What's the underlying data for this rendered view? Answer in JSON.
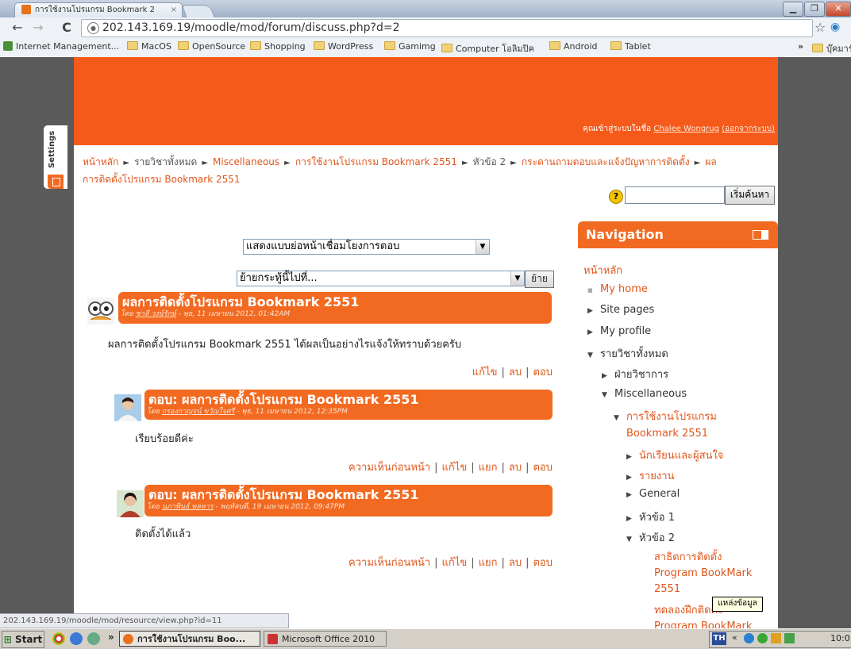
{
  "browser": {
    "tab_title": "การใช้งานโปรแกรม Bookmark 2",
    "tab_close": "×",
    "url": "202.143.169.19/moodle/mod/forum/discuss.php?d=2",
    "bookmarks": [
      "Internet Management...",
      "MacOS",
      "OpenSource",
      "Shopping",
      "WordPress",
      "Gamimg",
      "Computer โอลิมปิค",
      "Android",
      "Tablet"
    ],
    "bookmarks_more": "»",
    "other_bookmarks": "บุ๊คมาร์คอื่นๆ",
    "status_url": "202.143.169.19/moodle/mod/resource/view.php?id=11"
  },
  "header": {
    "login_prefix": "คุณเข้าสู่ระบบในชื่อ ",
    "user_name": "Chalee Wongrug",
    "logout": "(ออกจากระบบ)"
  },
  "settings_tab": {
    "label": "Settings"
  },
  "breadcrumb": {
    "home": "หน้าหลัก",
    "items": [
      "รายวิชาทั้งหมด",
      "Miscellaneous",
      "การใช้งานโปรแกรม Bookmark 2551",
      "หัวข้อ 2",
      "กระดานถามตอบและแจ้งปัญหาการติดตั้ง"
    ],
    "last_line1": "ผล",
    "last_line2": "การติดตั้งโปรแกรม Bookmark 2551",
    "separator": "►"
  },
  "search": {
    "help": "?",
    "button": "เริ่มค้นหา"
  },
  "forum": {
    "display_mode": "แสดงแบบย่อหน้าเชื่อมโยงการตอบ",
    "move_placeholder": "ย้ายกระทู้นี้ไปที่...",
    "move_button": "ย้าย"
  },
  "posts": [
    {
      "title": "ผลการติดตั้งโปรแกรม Bookmark 2551",
      "author_prefix": "โดย ",
      "author": "ชาลี วงษ์รักษ์",
      "date": " - พุธ, 11 เมษายน 2012, 01:42AM",
      "message": "ผลการติดตั้งโปรแกรม Bookmark 2551 ได้ผลเป็นอย่างไรแจ้งให้ทราบด้วยครับ",
      "commands": [
        "แก้ไข",
        "ลบ",
        "ตอบ"
      ]
    },
    {
      "title": "ตอบ: ผลการติดตั้งโปรแกรม Bookmark 2551",
      "author_prefix": "โดย ",
      "author": "กรองกาญจน์ ขวัญใจศรี",
      "date": " - พุธ, 11 เมษายน 2012, 12:35PM",
      "message": "เรียบร้อยดีค่ะ",
      "commands": [
        "ความเห็นก่อนหน้า",
        "แก้ไข",
        "แยก",
        "ลบ",
        "ตอบ"
      ]
    },
    {
      "title": "ตอบ: ผลการติดตั้งโปรแกรม Bookmark 2551",
      "author_prefix": "โดย ",
      "author": "นภาพินธ์ พลหาร",
      "date": " - พฤหัสบดี, 19 เมษายน 2012, 09:47PM",
      "message": "ติดตั้งได้แล้ว",
      "commands": [
        "ความเห็นก่อนหน้า",
        "แก้ไข",
        "แยก",
        "ลบ",
        "ตอบ"
      ]
    }
  ],
  "navigation": {
    "title": "Navigation",
    "home": "หน้าหลัก",
    "my_home": "My home",
    "site_pages": "Site pages",
    "my_profile": "My profile",
    "all_courses": "รายวิชาทั้งหมด",
    "academic": "ฝ่ายวิชาการ",
    "miscellaneous": "Miscellaneous",
    "course_line1": "การใช้งานโปรแกรม",
    "course_line2": "Bookmark 2551",
    "students": "นักเรียนและผู้สนใจ",
    "reports": "รายงาน",
    "general": "General",
    "topic1": "หัวข้อ 1",
    "topic2": "หัวข้อ 2",
    "demo_line1": "สาธิตการติดตั้ง",
    "demo_line2": "Program BookMark",
    "demo_line3": "2551",
    "practice_line1": "ทดลองฝึกติดตั้ง",
    "practice_line2": "Program BookMark"
  },
  "tooltip": "แหล่งข้อมูล",
  "taskbar": {
    "start": "Start",
    "more": "»",
    "task1": "การใช้งานโปรแกรม Boo...",
    "task2": "Microsoft Office 2010",
    "lang": "TH",
    "tray_more": "«",
    "clock": "10:0"
  },
  "colors": {
    "accent": "#f26a21",
    "header": "#f55a1b",
    "link": "#e0561c"
  }
}
